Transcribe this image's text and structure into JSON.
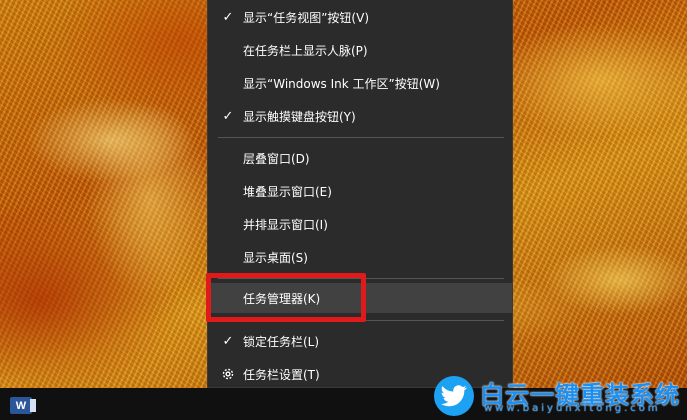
{
  "menu": {
    "items": [
      {
        "label": "显示“任务视图”按钮(V)",
        "checked": true
      },
      {
        "label": "在任务栏上显示人脉(P)",
        "checked": false
      },
      {
        "label": "显示“Windows Ink 工作区”按钮(W)",
        "checked": false
      },
      {
        "label": "显示触摸键盘按钮(Y)",
        "checked": true
      },
      {
        "label": "层叠窗口(D)",
        "checked": false
      },
      {
        "label": "堆叠显示窗口(E)",
        "checked": false
      },
      {
        "label": "并排显示窗口(I)",
        "checked": false
      },
      {
        "label": "显示桌面(S)",
        "checked": false
      },
      {
        "label": "任务管理器(K)",
        "checked": false,
        "highlighted": true
      },
      {
        "label": "锁定任务栏(L)",
        "checked": true
      },
      {
        "label": "任务栏设置(T)",
        "checked": false,
        "icon": "gear-icon"
      }
    ],
    "check_glyph": "✓"
  },
  "highlight_color": "#e0191b",
  "taskbar": {
    "word_icon_letter": "W"
  },
  "watermark": {
    "title": "白云一键重装系统",
    "url": "www.baiyunxitong.com",
    "logo_icon": "twitter-bird-icon",
    "color": "#1d8ff0"
  }
}
